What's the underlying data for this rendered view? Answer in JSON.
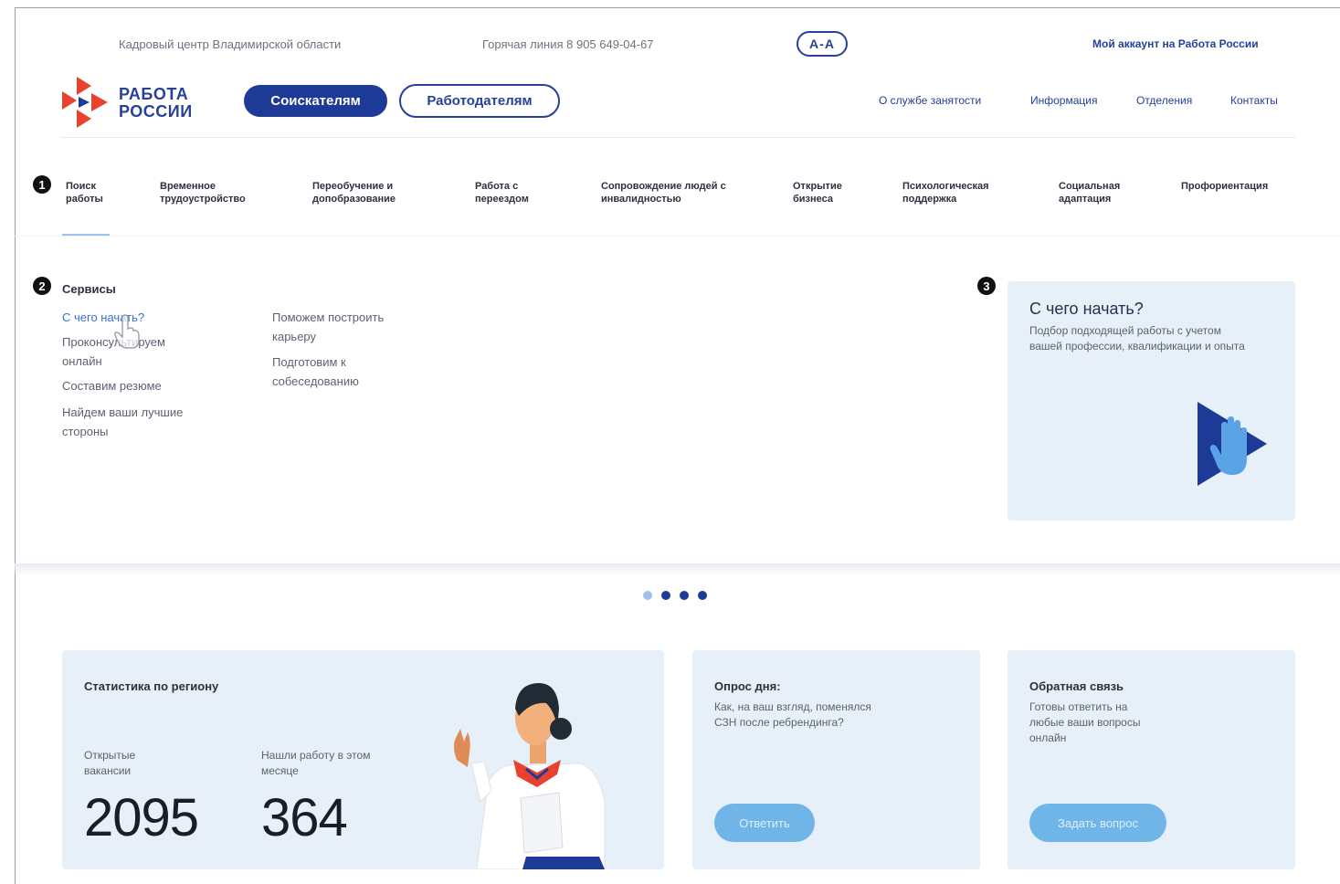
{
  "topbar": {
    "org": "Кадровый центр Владимирской области",
    "hotline": "Горячая линия 8 905 649-04-67",
    "font_toggle": "A-A",
    "account": "Мой аккаунт на Работа России"
  },
  "header": {
    "logo_line1": "РАБОТА",
    "logo_line2": "РОССИИ",
    "seekers": "Соискателям",
    "employers": "Работодателям",
    "nav": [
      "О службе занятости",
      "Информация",
      "Отделения",
      "Контакты"
    ]
  },
  "markers": [
    "1",
    "2",
    "3"
  ],
  "categories": [
    "Поиск работы",
    "Временное трудоустройство",
    "Переобучение и допобразование",
    "Работа с переездом",
    "Сопровождение людей с инвалидностью",
    "Открытие бизнеса",
    "Психологическая поддержка",
    "Социальная адаптация",
    "Профориентация"
  ],
  "services": {
    "title": "Сервисы",
    "col1": [
      "С чего начать?",
      "Проконсультируем онлайн",
      "Составим резюме",
      "Найдем ваши лучшие стороны"
    ],
    "col2": [
      "Поможем построить карьеру",
      "Подготовим к собеседованию"
    ]
  },
  "promo": {
    "title": "С чего начать?",
    "desc": "Подбор подходящей работы с учетом вашей профессии, квалификации и опыта"
  },
  "carousel": {
    "count": 4,
    "active": 1
  },
  "stats": {
    "title": "Статистика по региону",
    "label1": "Открытые вакансии",
    "value1": "2095",
    "label2": "Нашли работу в этом месяце",
    "value2": "364"
  },
  "poll": {
    "title": "Опрос дня:",
    "text": "Как, на ваш взгляд, поменялся СЗН после ребрендинга?",
    "button": "Ответить"
  },
  "feedback": {
    "title": "Обратная связь",
    "text": "Готовы ответить на любые ваши вопросы онлайн",
    "button": "Задать вопрос"
  },
  "colors": {
    "brand_blue": "#1d3a96",
    "brand_red": "#e8422f",
    "light_blue": "#e7eff9",
    "accent_button": "#6fb5e8"
  }
}
